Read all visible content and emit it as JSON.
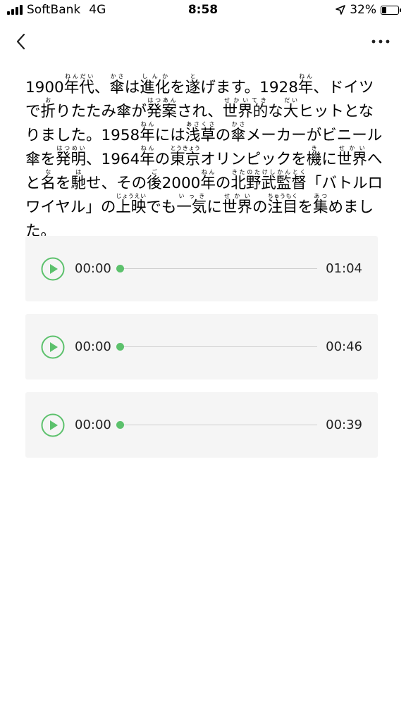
{
  "status_bar": {
    "carrier": "SoftBank",
    "network": "4G",
    "time": "8:58",
    "battery": "32%",
    "battery_level": 0.32
  },
  "nav": {
    "back_icon": "chevron-left-icon",
    "more_icon": "ellipsis-icon"
  },
  "article": {
    "text": "1900年代、傘は進化を遂げます。1928年、ドイツで折りたたみ傘が発案され、世界的な大ヒットとなりました。1958年には浅草の傘メーカーがビニール傘を発明、1964年の東京オリンピックを機に世界へと名を馳せ、その後2000年の北野武監督「バトルロワイヤル」の上映でも一気に世界の注目を集めました。",
    "segments": [
      {
        "base": "1900"
      },
      {
        "base": "年代",
        "ruby": "ねんだい"
      },
      {
        "base": "、"
      },
      {
        "base": "傘",
        "ruby": "かさ"
      },
      {
        "base": "は"
      },
      {
        "base": "進化",
        "ruby": "しんか"
      },
      {
        "base": "を"
      },
      {
        "base": "遂",
        "ruby": "と"
      },
      {
        "base": "げます。1928"
      },
      {
        "base": "年",
        "ruby": "ねん"
      },
      {
        "base": "、ドイツで"
      },
      {
        "base": "折",
        "ruby": "お"
      },
      {
        "base": "りたたみ傘が"
      },
      {
        "base": "発案",
        "ruby": "はつあん"
      },
      {
        "base": "され、"
      },
      {
        "base": "世界的",
        "ruby": "せかいてき"
      },
      {
        "base": "な"
      },
      {
        "base": "大",
        "ruby": "だい"
      },
      {
        "base": "ヒットとなりました。1958"
      },
      {
        "base": "年",
        "ruby": "ねん"
      },
      {
        "base": "には"
      },
      {
        "base": "浅草",
        "ruby": "あさくさ"
      },
      {
        "base": "の"
      },
      {
        "base": "傘",
        "ruby": "かさ"
      },
      {
        "base": "メーカーがビニール傘を"
      },
      {
        "base": "発明",
        "ruby": "はつめい"
      },
      {
        "base": "、1964"
      },
      {
        "base": "年",
        "ruby": "ねん"
      },
      {
        "base": "の"
      },
      {
        "base": "東京",
        "ruby": "とうきょう"
      },
      {
        "base": "オリンピックを"
      },
      {
        "base": "機",
        "ruby": "き"
      },
      {
        "base": "に"
      },
      {
        "base": "世界",
        "ruby": "せかい"
      },
      {
        "base": "へと"
      },
      {
        "base": "名",
        "ruby": "な"
      },
      {
        "base": "を"
      },
      {
        "base": "馳",
        "ruby": "は"
      },
      {
        "base": "せ、その"
      },
      {
        "base": "後",
        "ruby": "ご"
      },
      {
        "base": "2000"
      },
      {
        "base": "年",
        "ruby": "ねん"
      },
      {
        "base": "の"
      },
      {
        "base": "北野武",
        "ruby": "きたのたけし"
      },
      {
        "base": "監督",
        "ruby": "かんとく"
      },
      {
        "base": "「バトルロワイヤル」の"
      },
      {
        "base": "上映",
        "ruby": "じょうえい"
      },
      {
        "base": "でも"
      },
      {
        "base": "一気",
        "ruby": "いっき"
      },
      {
        "base": "に"
      },
      {
        "base": "世界",
        "ruby": "せかい"
      },
      {
        "base": "の"
      },
      {
        "base": "注目",
        "ruby": "ちゅうもく"
      },
      {
        "base": "を"
      },
      {
        "base": "集",
        "ruby": "あつ"
      },
      {
        "base": "めました。"
      }
    ]
  },
  "audio_players": [
    {
      "current": "00:00",
      "total": "01:04",
      "progress": 0,
      "play_icon": "play-icon"
    },
    {
      "current": "00:00",
      "total": "00:46",
      "progress": 0,
      "play_icon": "play-icon"
    },
    {
      "current": "00:00",
      "total": "00:39",
      "progress": 0,
      "play_icon": "play-icon"
    }
  ],
  "colors": {
    "accent": "#5cc16c",
    "card_background": "#f5f5f5",
    "track": "#cfcfcf"
  }
}
